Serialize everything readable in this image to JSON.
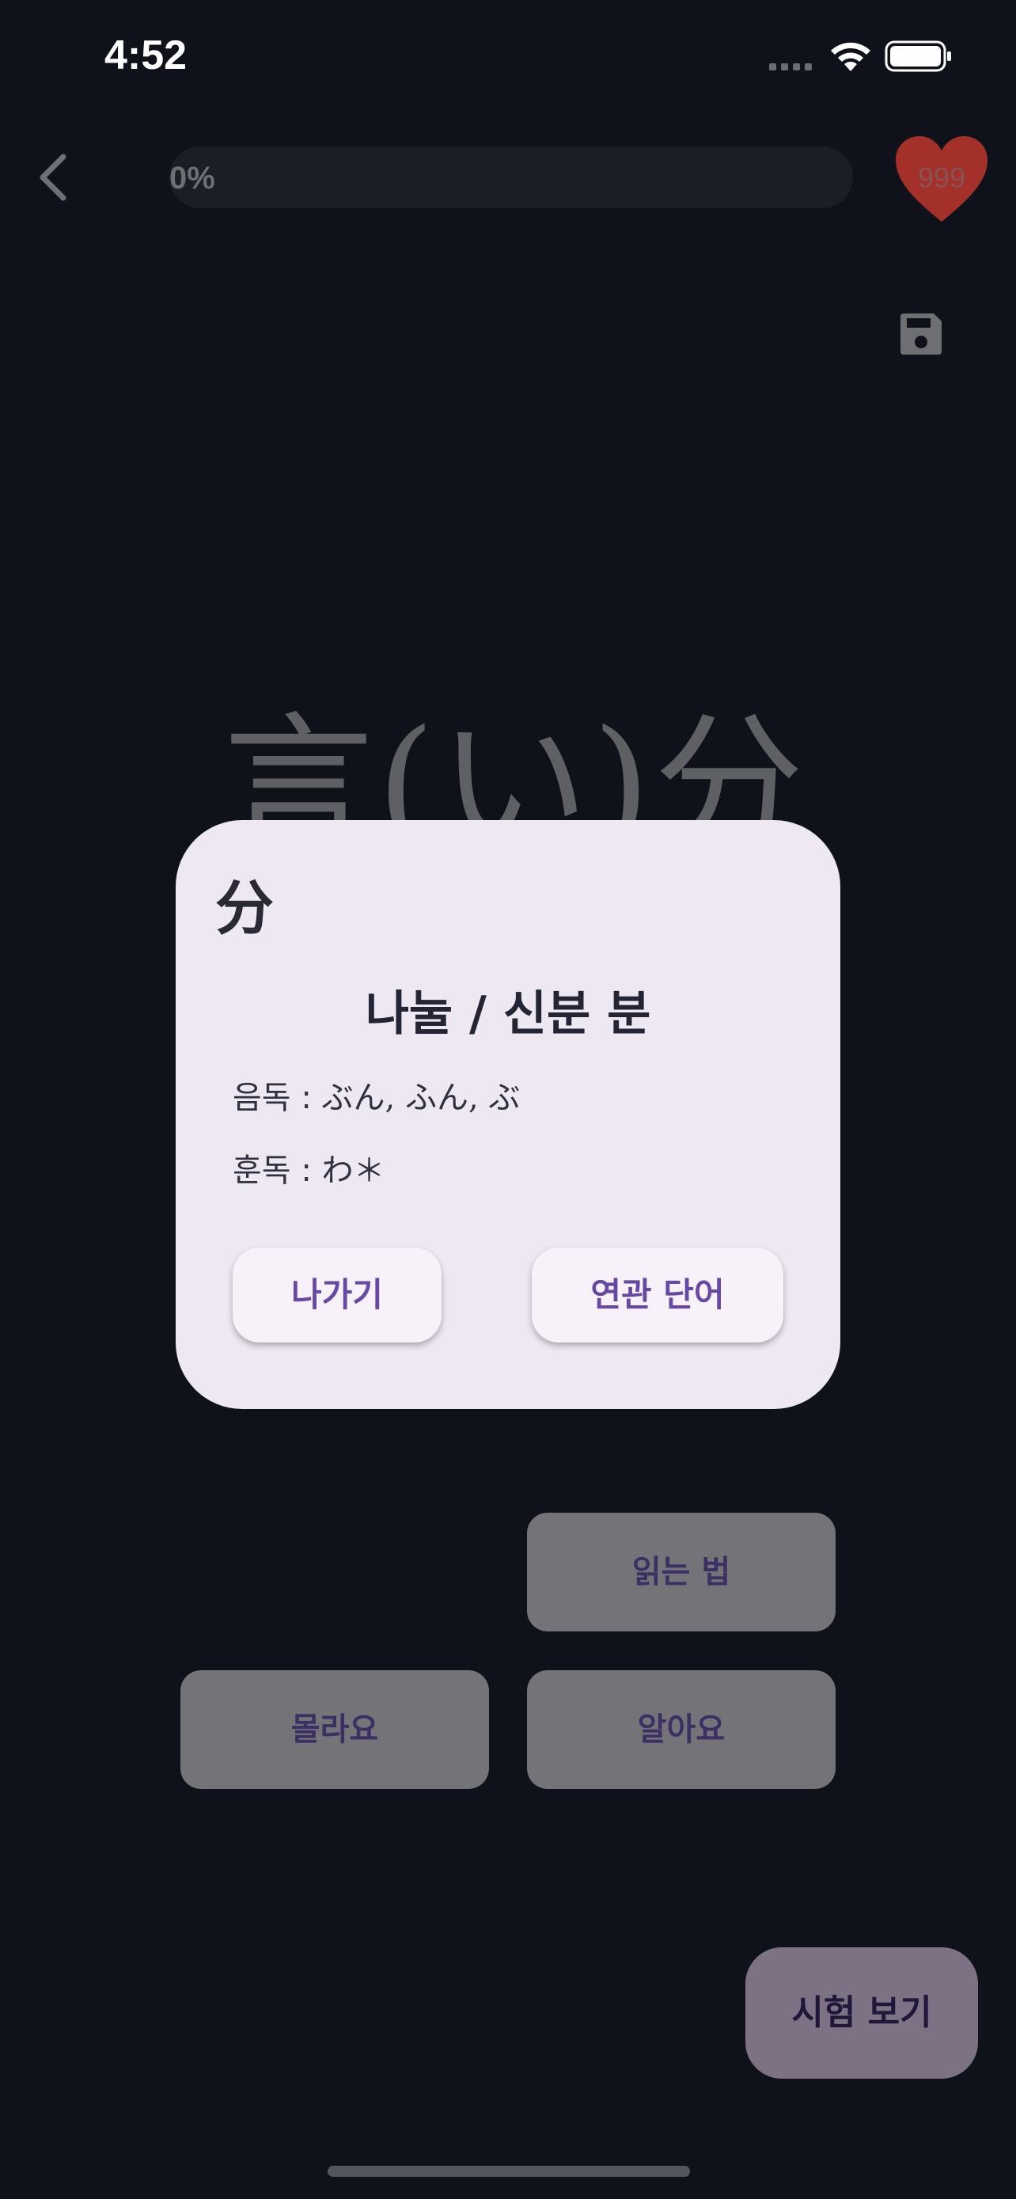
{
  "status_bar": {
    "time": "4:52"
  },
  "header": {
    "progress_label": "0%",
    "progress": 0,
    "lives": "999"
  },
  "word_card": {
    "word": "言(い)分"
  },
  "actions": {
    "reading_label": "읽는 법",
    "dont_know_label": "몰라요",
    "know_label": "알아요",
    "test_label": "시험 보기"
  },
  "kanji_dialog": {
    "kanji": "分",
    "meaning": "나눌 / 신분 분",
    "on_label": "음독 : ",
    "on_reading": "ぶん, ふん, ぶ",
    "kun_label": "훈독 : ",
    "kun_reading": "わ＊",
    "exit_label": "나가기",
    "related_label": "연관 단어"
  },
  "colors": {
    "background": "#0f121a",
    "dialog": "#ede8f2",
    "accent": "#6748a4",
    "heart": "#c0312b"
  },
  "icons": [
    "back-chevron-icon",
    "heart-icon",
    "save-icon",
    "wifi-icon",
    "battery-icon",
    "signal-icon"
  ]
}
